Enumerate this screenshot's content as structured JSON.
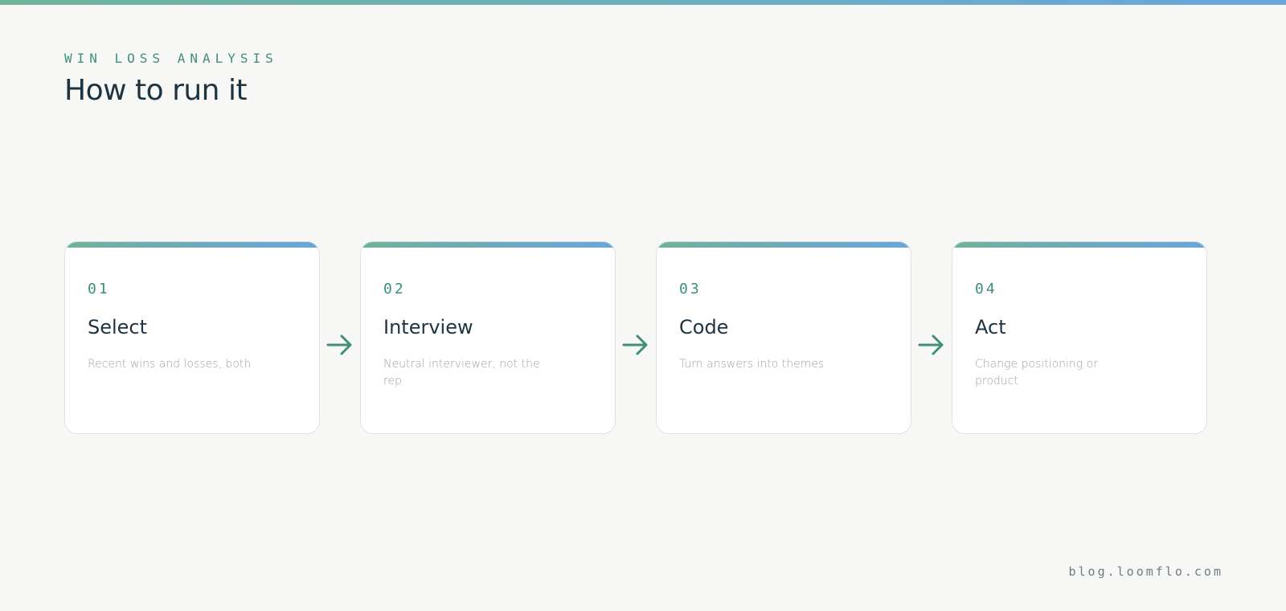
{
  "header": {
    "eyebrow": "WIN LOSS ANALYSIS",
    "title": "How to run it"
  },
  "steps": [
    {
      "number": "01",
      "title": "Select",
      "description": "Recent wins and losses, both"
    },
    {
      "number": "02",
      "title": "Interview",
      "description": "Neutral interviewer, not the rep"
    },
    {
      "number": "03",
      "title": "Code",
      "description": "Turn answers into themes"
    },
    {
      "number": "04",
      "title": "Act",
      "description": "Change positioning or product"
    }
  ],
  "footer": {
    "url": "blog.loomflo.com"
  },
  "colors": {
    "accent": "#3f8d7c",
    "gradient_start": "#6fb39a",
    "gradient_end": "#6aa6dd",
    "title": "#1d3440",
    "background": "#f7f7f5"
  },
  "icons": {
    "connector": "arrow-right-icon"
  }
}
